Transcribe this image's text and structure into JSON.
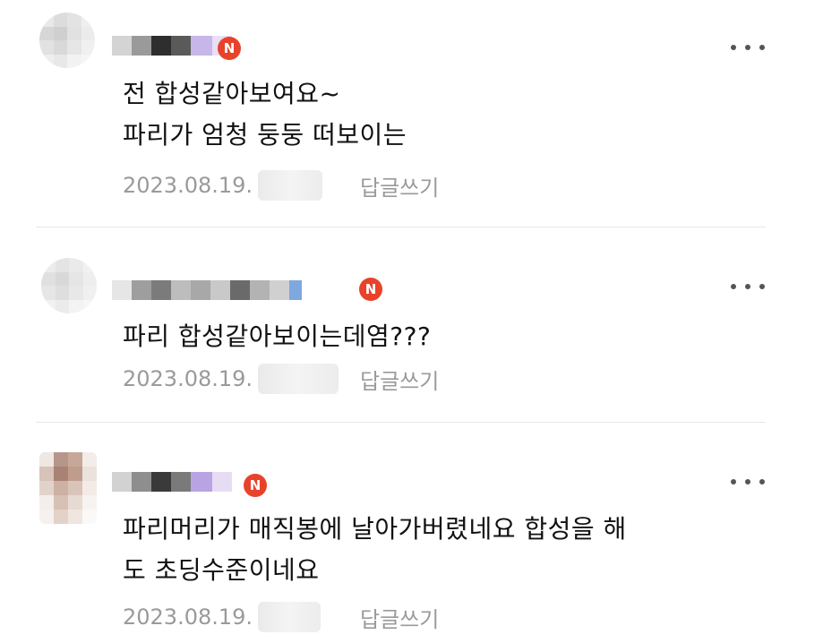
{
  "badge_letter": "N",
  "colors": {
    "badge": "#e8422b",
    "text": "#111111",
    "meta": "#9a9a9a",
    "divider": "#e6e6e6"
  },
  "comments": [
    {
      "lines": [
        "전 합성같아보여요~",
        "파리가 엄청 둥둥 떠보이는"
      ],
      "date": "2023.08.19.",
      "reply_label": "답글쓰기",
      "avatar_note": "blurred",
      "username_note": "blurred"
    },
    {
      "lines": [
        "파리 합성같아보이는데염???"
      ],
      "date": "2023.08.19.",
      "reply_label": "답글쓰기",
      "avatar_note": "blurred",
      "username_note": "blurred"
    },
    {
      "lines": [
        "파리머리가 매직봉에 날아가버렸네요 합성을 해",
        "도 초딩수준이네요"
      ],
      "date": "2023.08.19.",
      "reply_label": "답글쓰기",
      "avatar_note": "blurred",
      "username_note": "blurred"
    }
  ]
}
